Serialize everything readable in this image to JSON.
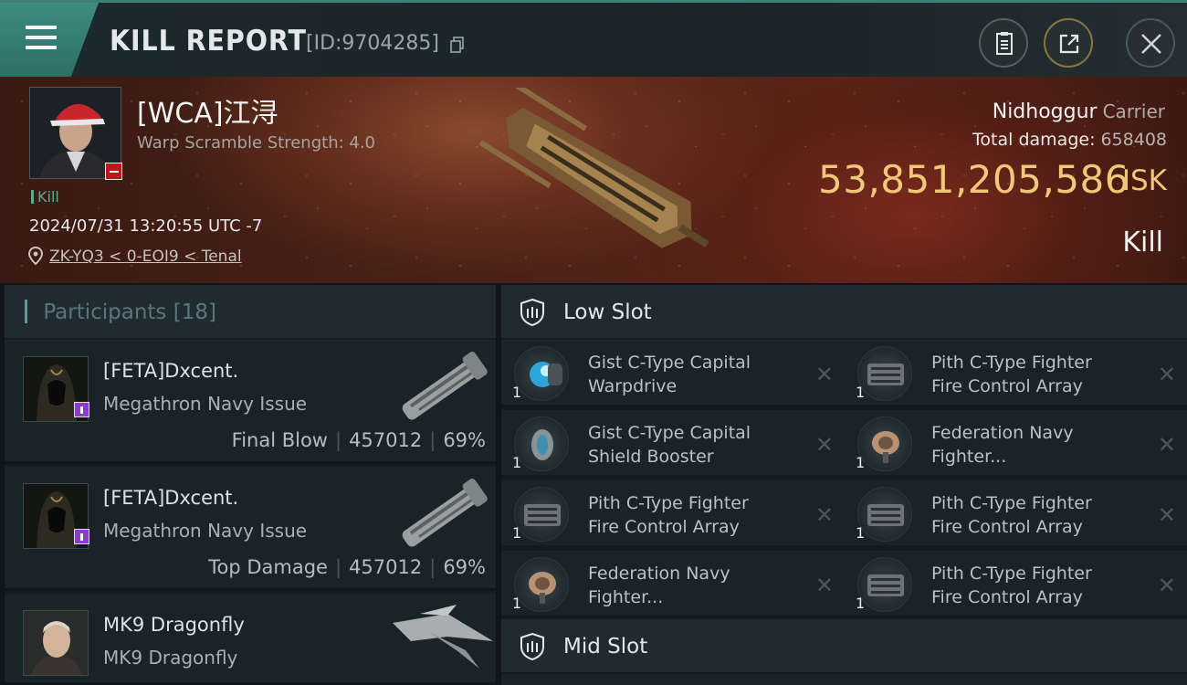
{
  "header": {
    "title": "KILL REPORT",
    "report_id": "[ID:9704285]"
  },
  "victim": {
    "name": "[WCA]江浔",
    "warp_scramble": "Warp Scramble Strength: 4.0",
    "kill_tag": "Kill",
    "datetime": "2024/07/31 13:20:55 UTC -7",
    "location": "ZK-YQ3 < 0-EOI9 < Tenal",
    "ship_name": "Nidhoggur",
    "ship_class": "Carrier",
    "total_damage_label": "Total damage:",
    "total_damage_value": "658408",
    "isk_value": "53,851,205,586",
    "isk_unit": "ISK",
    "result": "Kill"
  },
  "participants": {
    "title": "Participants",
    "count": "[18]",
    "items": [
      {
        "name": "[FETA]Dxcent.",
        "ship": "Megathron Navy Issue",
        "role": "Final Blow",
        "damage": "457012",
        "percent": "69%"
      },
      {
        "name": "[FETA]Dxcent.",
        "ship": "Megathron Navy Issue",
        "role": "Top Damage",
        "damage": "457012",
        "percent": "69%"
      },
      {
        "name": "MK9 Dragonfly",
        "ship": "MK9 Dragonfly",
        "role": "",
        "damage": "",
        "percent": ""
      }
    ]
  },
  "slots": {
    "low_slot_label": "Low Slot",
    "mid_slot_label": "Mid Slot",
    "modules": [
      {
        "qty": "1",
        "line1": "Gist C-Type Capital",
        "line2": "Warpdrive"
      },
      {
        "qty": "1",
        "line1": "Pith C-Type Fighter",
        "line2": "Fire Control Array"
      },
      {
        "qty": "1",
        "line1": "Gist C-Type Capital",
        "line2": "Shield Booster"
      },
      {
        "qty": "1",
        "line1": "Federation Navy",
        "line2": "Fighter..."
      },
      {
        "qty": "1",
        "line1": "Pith C-Type Fighter",
        "line2": "Fire Control Array"
      },
      {
        "qty": "1",
        "line1": "Pith C-Type Fighter",
        "line2": "Fire Control Array"
      },
      {
        "qty": "1",
        "line1": "Federation Navy",
        "line2": "Fighter..."
      },
      {
        "qty": "1",
        "line1": "Pith C-Type Fighter",
        "line2": "Fire Control Array"
      }
    ]
  },
  "colors": {
    "accent_teal": "#3d8c80",
    "isk_gold": "#f1c77a",
    "corp_red": "#c0151b",
    "alliance_purple": "#8b3ad3"
  },
  "icons": {
    "menu": "hamburger-icon",
    "copy": "copy-icon",
    "document": "document-icon",
    "share": "share-icon",
    "close": "close-icon",
    "location": "location-pin-icon",
    "slot": "shield-slot-icon",
    "remove": "x-icon"
  }
}
